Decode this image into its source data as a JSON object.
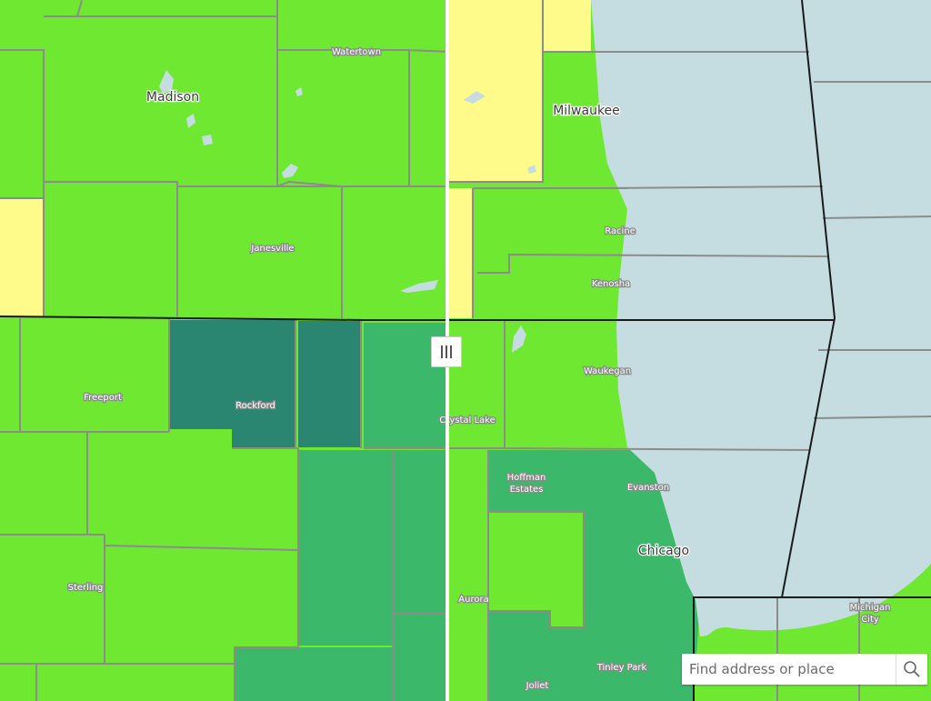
{
  "map": {
    "colors": {
      "low": "#6fe832",
      "lowest": "#fffb8a",
      "medium": "#3bb86a",
      "high": "#2a8571",
      "water": "#c5dde0",
      "county_border": "#8c8c8c",
      "state_border": "#1a1a1a"
    },
    "labels": {
      "madison": "Madison",
      "milwaukee": "Milwaukee",
      "watertown": "Watertown",
      "janesville": "Janesville",
      "racine": "Racine",
      "kenosha": "Kenosha",
      "waukegan": "Waukegan",
      "freeport": "Freeport",
      "rockford": "Rockford",
      "crystal_lake": "Crystal Lake",
      "hoffman_1": "Hoffman",
      "hoffman_2": "Estates",
      "evanston": "Evanston",
      "chicago": "Chicago",
      "sterling": "Sterling",
      "aurora": "Aurora",
      "michigan_1": "Michigan",
      "michigan_2": "City",
      "tinley_park": "Tinley Park",
      "joliet": "Joliet"
    }
  },
  "swipe": {
    "handle_icon": "grip-vertical-icon"
  },
  "search": {
    "placeholder": "Find address or place",
    "icon": "search-icon"
  }
}
